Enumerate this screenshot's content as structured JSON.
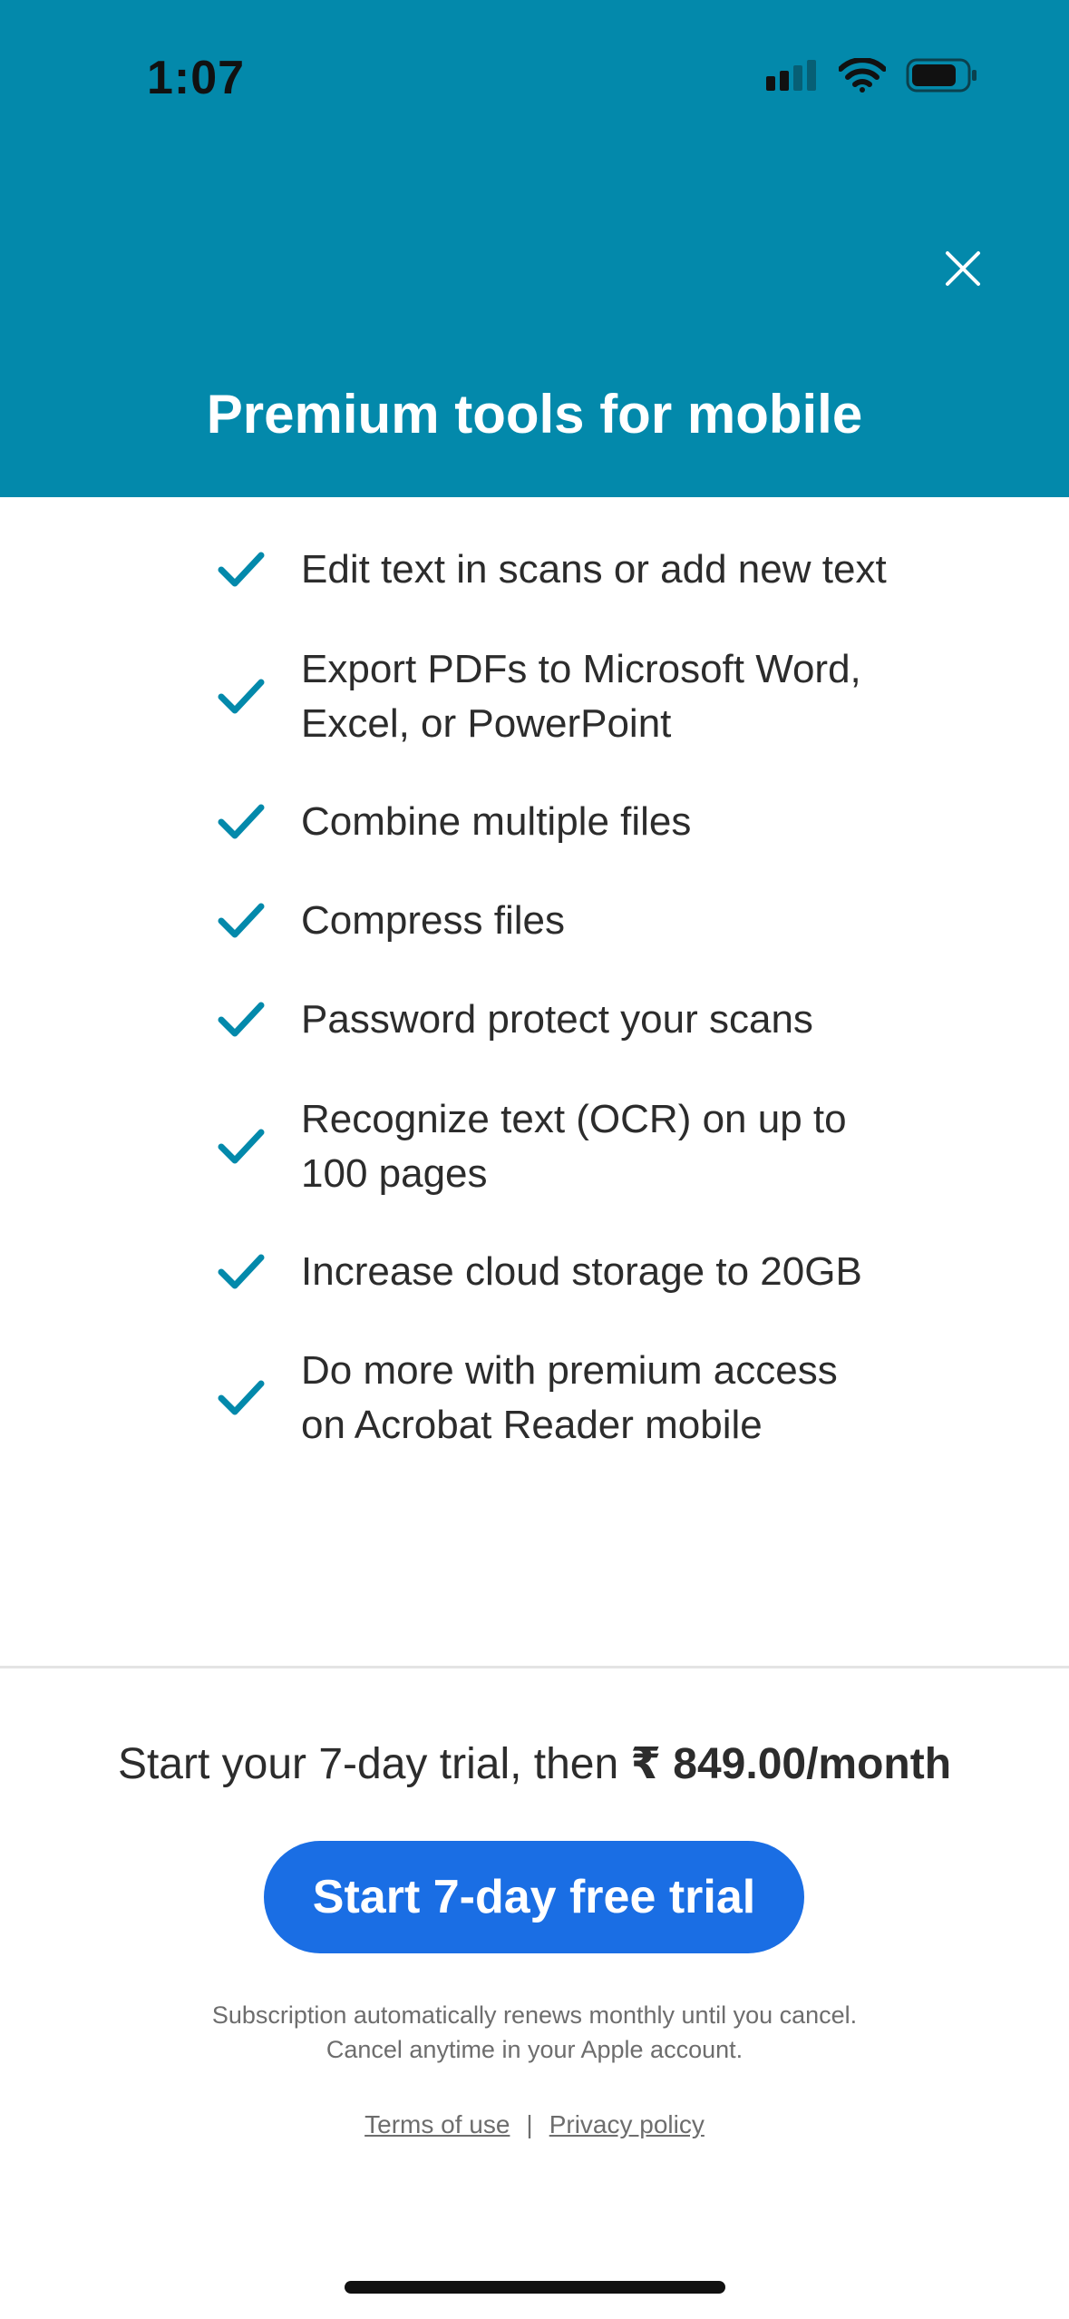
{
  "status_bar": {
    "time": "1:07",
    "icons": [
      "cellular-signal-icon",
      "wifi-icon",
      "battery-icon"
    ]
  },
  "header": {
    "title": "Premium tools for mobile",
    "close_icon": "close-icon",
    "background_color": "#0389ab"
  },
  "features": [
    {
      "line1": "Edit text in scans or add new text",
      "line2": ""
    },
    {
      "line1": "Export PDFs to Microsoft Word,",
      "line2": "Excel, or PowerPoint"
    },
    {
      "line1": "Combine multiple files",
      "line2": ""
    },
    {
      "line1": "Compress files",
      "line2": ""
    },
    {
      "line1": "Password protect your scans",
      "line2": ""
    },
    {
      "line1": "Recognize text (OCR) on up to",
      "line2": "100 pages"
    },
    {
      "line1": "Increase cloud storage to 20GB",
      "line2": ""
    },
    {
      "line1": "Do more with premium access",
      "line2": "on Acrobat Reader mobile"
    }
  ],
  "check_color": "#0389ab",
  "offer": {
    "prefix": "Start your 7-day trial, then ",
    "price": "₹ 849.00/month"
  },
  "cta": {
    "label": "Start 7-day free trial",
    "color": "#1a6ee4"
  },
  "disclaimer": {
    "line1": "Subscription automatically renews monthly until you cancel.",
    "line2": "Cancel anytime in your Apple account."
  },
  "links": {
    "terms": "Terms of use",
    "separator": "|",
    "privacy": "Privacy policy"
  }
}
